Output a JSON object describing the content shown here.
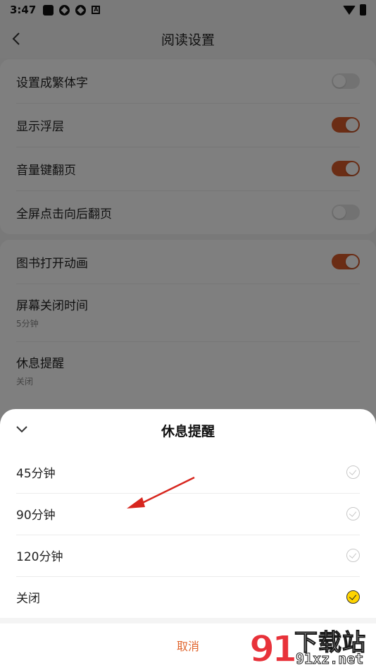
{
  "status_bar": {
    "time": "3:47",
    "icons": [
      "square-icon",
      "sync-icon",
      "sync-icon",
      "font-a-icon"
    ],
    "right_icons": [
      "wifi-icon",
      "battery-icon"
    ]
  },
  "header": {
    "title": "阅读设置"
  },
  "settings_group_1": [
    {
      "label": "设置成繁体字",
      "toggle": "off"
    },
    {
      "label": "显示浮层",
      "toggle": "on"
    },
    {
      "label": "音量键翻页",
      "toggle": "on"
    },
    {
      "label": "全屏点击向后翻页",
      "toggle": "off"
    }
  ],
  "settings_group_2": {
    "book_animation": {
      "label": "图书打开动画",
      "toggle": "on"
    },
    "screen_off": {
      "label": "屏幕关闭时间",
      "value": "5分钟"
    },
    "rest_reminder": {
      "label": "休息提醒",
      "value": "关闭"
    }
  },
  "sheet": {
    "title": "休息提醒",
    "options": [
      {
        "label": "45分钟",
        "selected": false
      },
      {
        "label": "90分钟",
        "selected": false
      },
      {
        "label": "120分钟",
        "selected": false
      },
      {
        "label": "关闭",
        "selected": true
      }
    ],
    "cancel_label": "取消"
  },
  "watermark": {
    "brand_text": "下载站",
    "url_text": "91xz.net"
  },
  "colors": {
    "accent": "#d65a2a",
    "cancel": "#e0642c",
    "selected_check": "#ffd400",
    "annotation_arrow": "#d7261e"
  }
}
